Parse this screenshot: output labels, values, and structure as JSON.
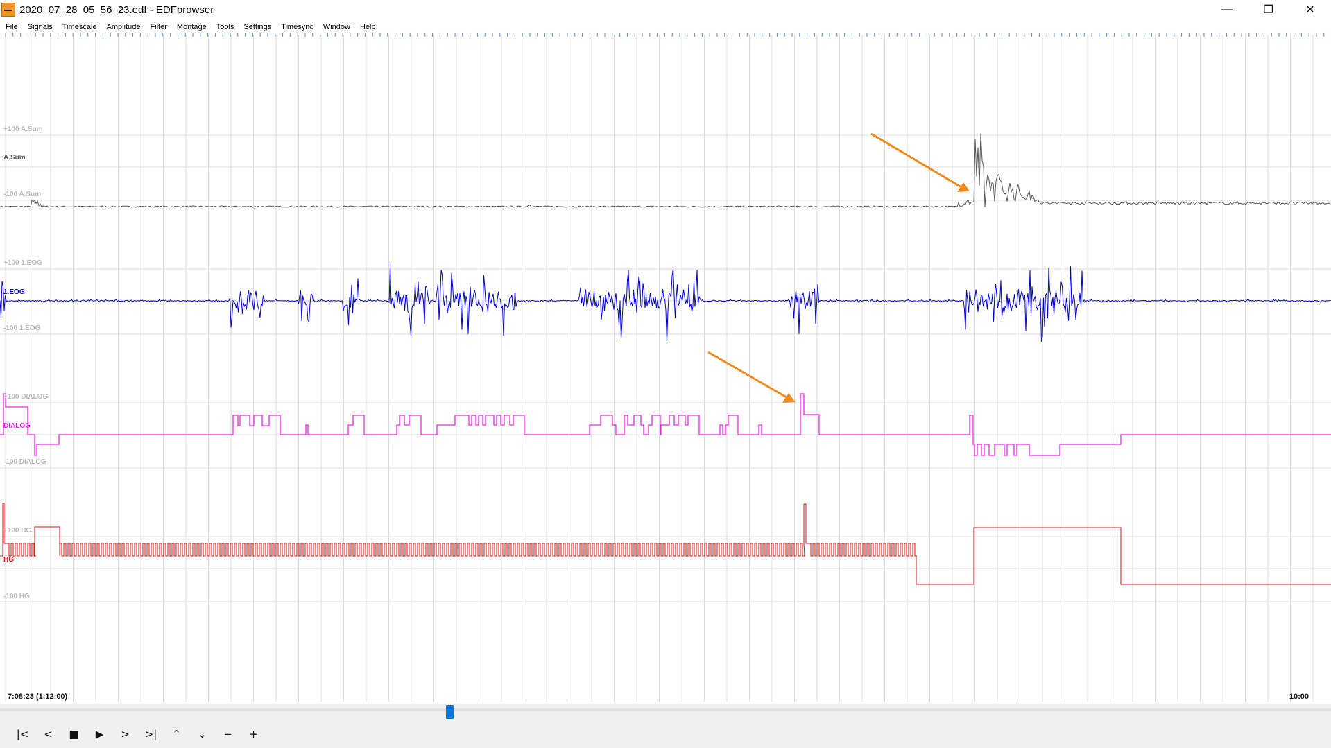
{
  "window": {
    "title": "2020_07_28_05_56_23.edf - EDFbrowser",
    "minimize": "—",
    "restore": "❐",
    "close": "✕"
  },
  "menu": [
    "File",
    "Signals",
    "Timescale",
    "Amplitude",
    "Filter",
    "Montage",
    "Tools",
    "Settings",
    "Timesync",
    "Window",
    "Help"
  ],
  "signals": [
    {
      "name": "A.Sum",
      "upper": "+100 A.Sum",
      "lower": "-100 A.Sum",
      "color": "#555555"
    },
    {
      "name": "1.EOG",
      "upper": "+100 1.EOG",
      "lower": "-100 1.EOG",
      "color": "#0000cc"
    },
    {
      "name": "DIALOG",
      "upper": "+100 DIALOG",
      "lower": "-100 DIALOG",
      "color": "#ee22ee"
    },
    {
      "name": "HG",
      "upper": "+100 HG",
      "lower": "-100 HG",
      "color": "#dd1111"
    }
  ],
  "annotation_color": "#f08a1c",
  "timeline": {
    "start": "7:08:23 (1:12:00)",
    "end": "10:00",
    "position_fraction": 0.337
  },
  "toolbar": {
    "first": "|<",
    "prev": "<",
    "stop": "■",
    "play": "▶",
    "next": ">",
    "last": ">|",
    "up": "⌃",
    "down": "⌄",
    "minus": "−",
    "plus": "+"
  }
}
